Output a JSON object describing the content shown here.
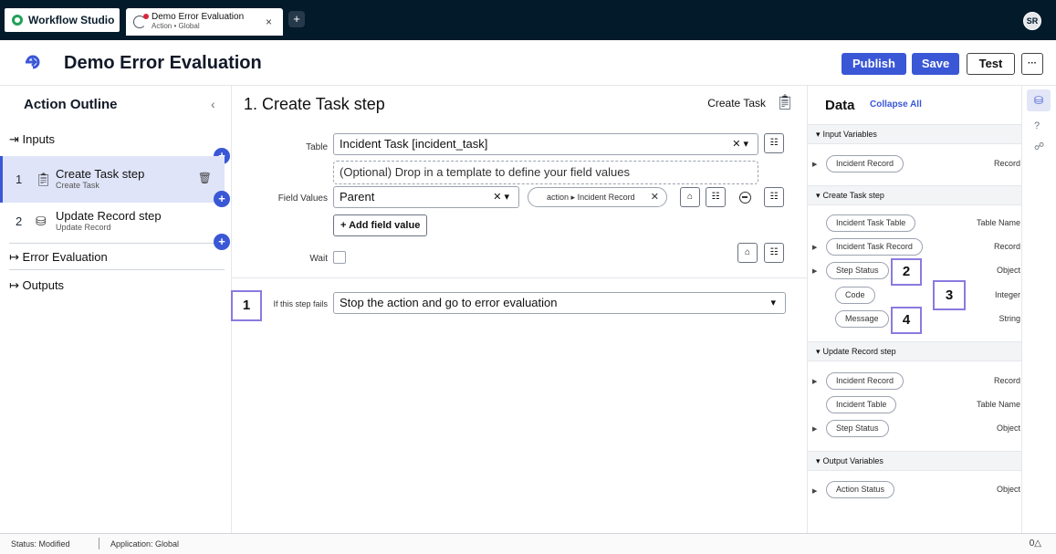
{
  "tabs": {
    "app_name": "Workflow Studio",
    "doc_title": "Demo Error Evaluation",
    "doc_subtitle": "Action • Global",
    "close": "×",
    "add": "+",
    "avatar": "SR"
  },
  "header": {
    "title": "Demo Error Evaluation",
    "publish": "Publish",
    "save": "Save",
    "test": "Test",
    "more": "···"
  },
  "outline": {
    "title": "Action Outline",
    "collapse": "‹",
    "inputs": "Inputs",
    "steps": [
      {
        "num": "1",
        "label": "Create Task step",
        "sub": "Create Task"
      },
      {
        "num": "2",
        "label": "Update Record step",
        "sub": "Update Record"
      }
    ],
    "error_evaluation": "Error Evaluation",
    "outputs": "Outputs"
  },
  "main": {
    "heading": "1.  Create Task step",
    "step_type": "Create Task",
    "table_label": "Table",
    "table_value": "Incident Task [incident_task]",
    "template_placeholder": "(Optional) Drop in a template to define your field values",
    "field_values_label": "Field Values",
    "field_name": "Parent",
    "field_pill_prefix": "action",
    "field_pill_value": "Incident Record",
    "add_field_value": "Add field value",
    "wait_label": "Wait",
    "fail_label": "If this step fails",
    "fail_value": "Stop the action and go to error evaluation"
  },
  "callouts": [
    "1",
    "2",
    "3",
    "4"
  ],
  "data_panel": {
    "title": "Data",
    "collapse_all": "Collapse All",
    "sections": [
      {
        "title": "Input Variables",
        "rows": [
          {
            "pill": "Incident Record",
            "type": "Record",
            "expandable": true
          }
        ]
      },
      {
        "title": "Create Task step",
        "rows": [
          {
            "pill": "Incident Task Table",
            "type": "Table Name",
            "expandable": false
          },
          {
            "pill": "Incident Task Record",
            "type": "Record",
            "expandable": true
          },
          {
            "pill": "Step Status",
            "type": "Object",
            "expandable": true
          },
          {
            "pill": "Code",
            "type": "Integer",
            "expandable": false
          },
          {
            "pill": "Message",
            "type": "String",
            "expandable": false
          }
        ]
      },
      {
        "title": "Update Record step",
        "rows": [
          {
            "pill": "Incident Record",
            "type": "Record",
            "expandable": true
          },
          {
            "pill": "Incident Table",
            "type": "Table Name",
            "expandable": false
          },
          {
            "pill": "Step Status",
            "type": "Object",
            "expandable": true
          }
        ]
      },
      {
        "title": "Output Variables",
        "rows": [
          {
            "pill": "Action Status",
            "type": "Object",
            "expandable": true
          }
        ]
      }
    ]
  },
  "status": {
    "status_text": "Status: Modified",
    "application_text": "Application: Global",
    "alerts": "0△"
  },
  "colors": {
    "accent": "#3a57d6",
    "topbar": "#031a2a",
    "callout_border": "#8b7ae0"
  }
}
